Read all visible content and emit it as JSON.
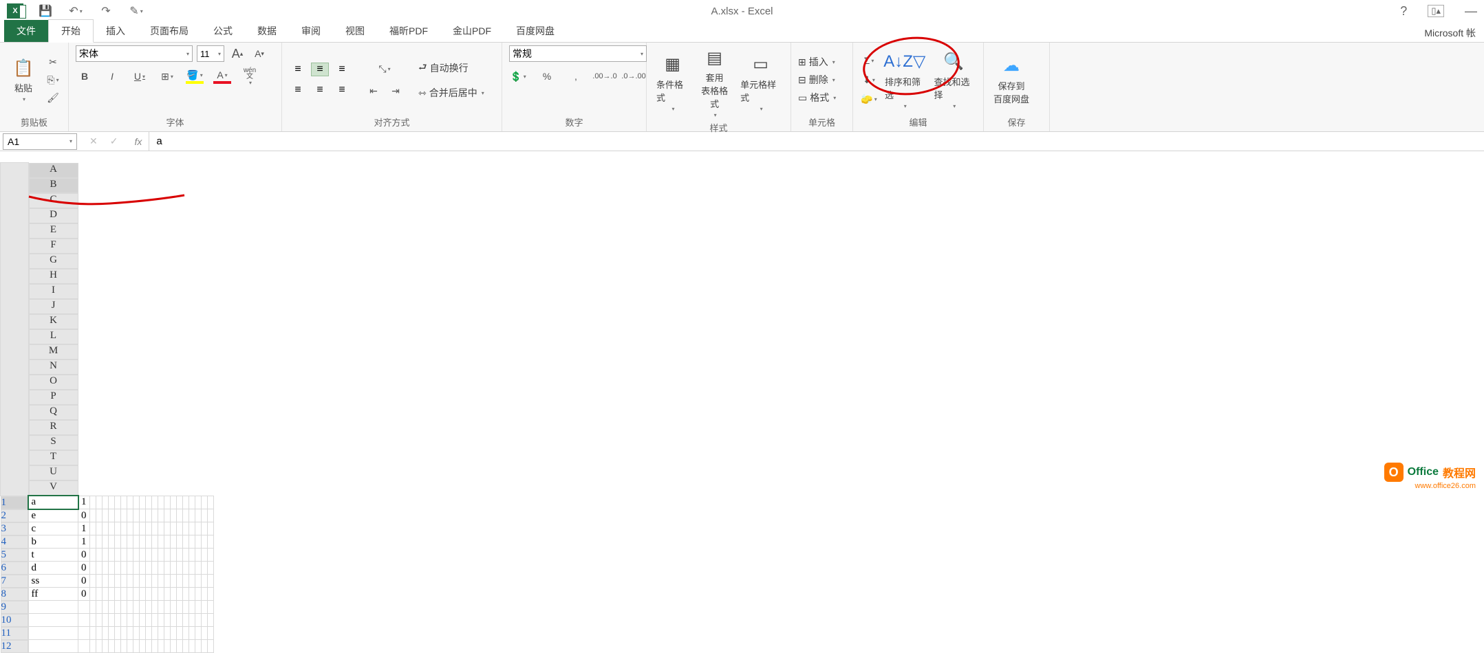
{
  "title": "A.xlsx - Excel",
  "ms_account": "Microsoft 帐",
  "tabs": {
    "file": "文件",
    "home": "开始",
    "insert": "插入",
    "layout": "页面布局",
    "formulas": "公式",
    "data": "数据",
    "review": "审阅",
    "view": "视图",
    "foxit": "福昕PDF",
    "kingsoft": "金山PDF",
    "baidu": "百度网盘"
  },
  "ribbon": {
    "clipboard": {
      "label": "剪贴板",
      "paste": "粘贴"
    },
    "font": {
      "label": "字体",
      "name": "宋体",
      "size": "11",
      "wen": "wén",
      "wen2": "文"
    },
    "align": {
      "label": "对齐方式",
      "wrap": "自动换行",
      "merge": "合并后居中"
    },
    "number": {
      "label": "数字",
      "format": "常规"
    },
    "styles": {
      "label": "样式",
      "cond": "条件格式",
      "table": "套用\n表格格式",
      "cell": "单元格样式"
    },
    "cells": {
      "label": "单元格",
      "insert": "插入",
      "delete": "删除",
      "format": "格式"
    },
    "editing": {
      "label": "编辑",
      "sort": "排序和筛选",
      "find": "查找和选择"
    },
    "save": {
      "label": "保存",
      "btn": "保存到\n百度网盘"
    }
  },
  "namebox": "A1",
  "formula": "a",
  "columns": [
    "A",
    "B",
    "C",
    "D",
    "E",
    "F",
    "G",
    "H",
    "I",
    "J",
    "K",
    "L",
    "M",
    "N",
    "O",
    "P",
    "Q",
    "R",
    "S",
    "T",
    "U",
    "V"
  ],
  "rows": [
    "1",
    "2",
    "3",
    "4",
    "5",
    "6",
    "7",
    "8",
    "9",
    "10",
    "11",
    "12"
  ],
  "cells": {
    "A": [
      "a",
      "e",
      "c",
      "b",
      "t",
      "d",
      "ss",
      "ff",
      "",
      "",
      "",
      ""
    ],
    "B": [
      "1",
      "0",
      "1",
      "1",
      "0",
      "0",
      "0",
      "0",
      "",
      "",
      "",
      ""
    ]
  },
  "watermark": {
    "brand1": "Office",
    "brand2": "教程网",
    "url": "www.office26.com"
  }
}
